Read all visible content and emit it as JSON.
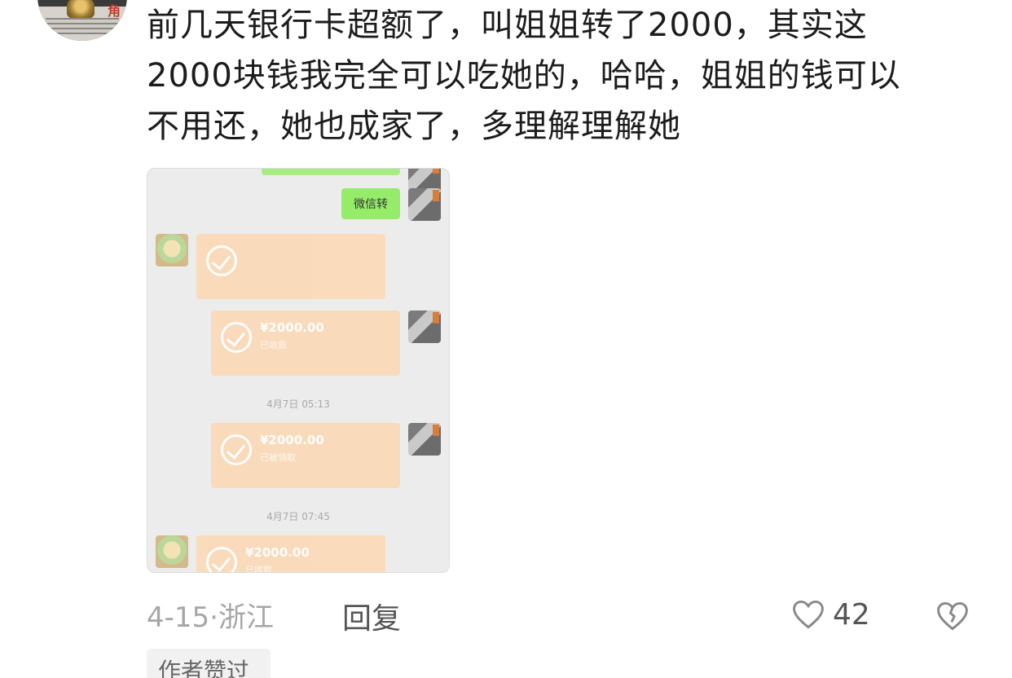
{
  "comment": {
    "avatar_char": "角",
    "lines": [
      "前几天银行卡超额了，叫姐姐转了2000，其实这",
      "2000块钱我完全可以吃她的，哈哈，姐姐的钱可以",
      "不用还，她也成家了，多理解理解她"
    ],
    "date": "4-15",
    "location": "浙江",
    "reply_label": "回复",
    "likes": "42",
    "author_liked_badge": "作者赞过"
  },
  "screenshot": {
    "green_message": "微信转",
    "transfers": [
      {
        "amount": "",
        "status": "",
        "note": ""
      },
      {
        "amount": "¥2000.00",
        "status": "已收款",
        "note": ""
      },
      {
        "amount": "¥2000.00",
        "status": "已被领取",
        "note": ""
      },
      {
        "amount": "¥2000.00",
        "status": "已收款",
        "note": ""
      }
    ],
    "timestamps": [
      "4月7日 05:13",
      "4月7日 07:45"
    ]
  },
  "colors": {
    "text": "#1c1c1c",
    "muted": "#a6a6a6",
    "wechat_green": "#95ec69",
    "transfer_orange": "#fbd9b7"
  },
  "icons": [
    "heart-outline-icon",
    "broken-heart-icon",
    "check-circle-icon"
  ]
}
